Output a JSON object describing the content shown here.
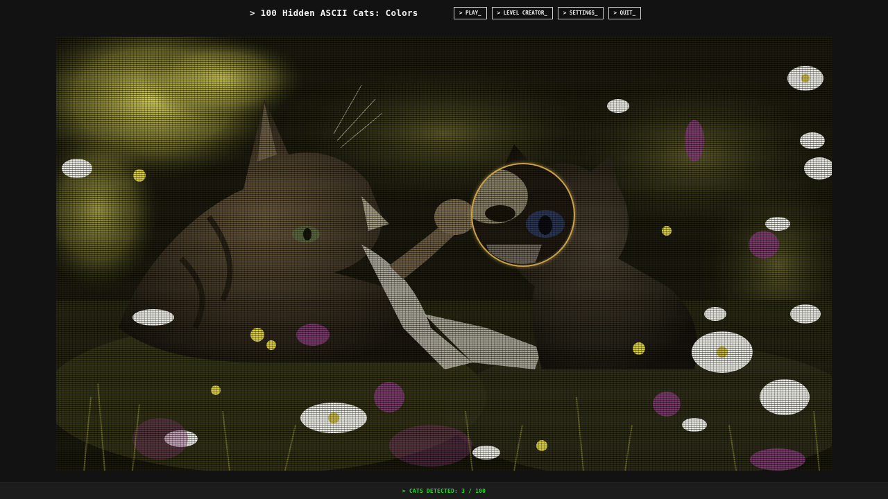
{
  "header": {
    "title": "> 100 Hidden ASCII Cats: Colors",
    "menu": [
      {
        "label": "> PLAY_"
      },
      {
        "label": "> LEVEL CREATOR_"
      },
      {
        "label": "> SETTINGS_"
      },
      {
        "label": "> QUIT_"
      }
    ]
  },
  "status": {
    "text": "> CATS DETECTED: 3 / 100",
    "found": 3,
    "total": 100
  },
  "icons": {
    "lens": "magnifier-lens-icon"
  },
  "colors": {
    "background": "#121212",
    "status_green": "#22e02a",
    "lens_border": "#c9a24a",
    "field_yellow": "#d8d24a",
    "flower_white": "#eeeeee",
    "flower_purple": "#8a3a7a"
  }
}
